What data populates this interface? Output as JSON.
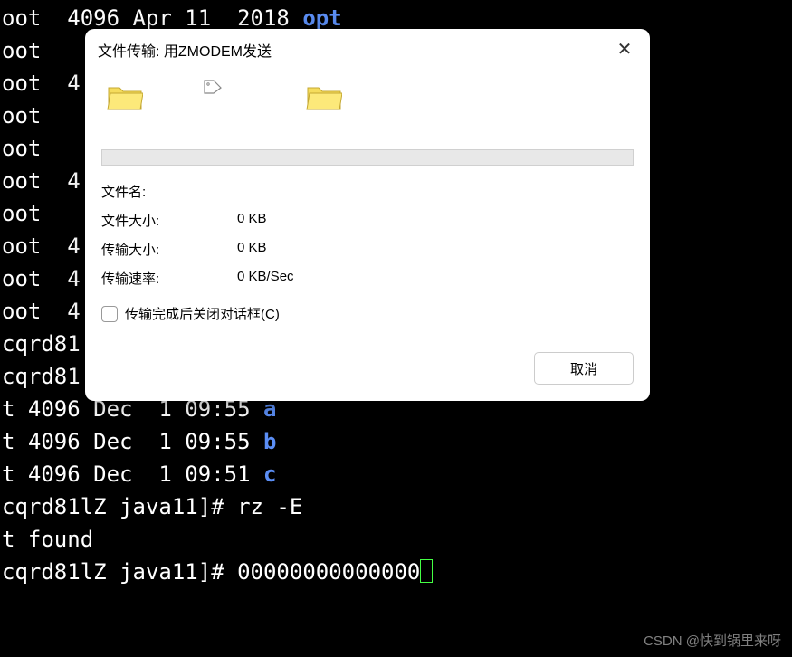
{
  "terminal": {
    "lines": [
      {
        "prefix": "oot  4096 Apr 11  2018 ",
        "suffix": "opt",
        "suffixClass": "term-blue"
      },
      {
        "prefix": "oot",
        "suffix": ""
      },
      {
        "prefix": "oot  4",
        "suffix": ""
      },
      {
        "prefix": "oot",
        "suffix": ""
      },
      {
        "prefix": "oot",
        "suffix": ""
      },
      {
        "prefix": "oot  4",
        "suffix": ""
      },
      {
        "prefix": "oot",
        "suffix": ""
      },
      {
        "prefix": "oot  4",
        "suffix": ""
      },
      {
        "prefix": "oot  4",
        "suffix": ""
      },
      {
        "prefix": "oot  4",
        "suffix": ""
      },
      {
        "prefix": "cqrd81",
        "suffix": ""
      },
      {
        "prefix": "cqrd81",
        "suffix": ""
      },
      {
        "prefix": "",
        "suffix": ""
      },
      {
        "prefix": "t 4096 Dec  1 09:55 ",
        "suffix": "a",
        "suffixClass": "term-blue"
      },
      {
        "prefix": "t 4096 Dec  1 09:55 ",
        "suffix": "b",
        "suffixClass": "term-blue"
      },
      {
        "prefix": "t 4096 Dec  1 09:51 ",
        "suffix": "c",
        "suffixClass": "term-blue"
      },
      {
        "prefix": "cqrd81lZ java11]# rz -E",
        "suffix": ""
      },
      {
        "prefix": "t found",
        "suffix": ""
      },
      {
        "prefix": "cqrd81lZ java11]# 00000000000000",
        "suffix": "",
        "hasCursor": true
      }
    ]
  },
  "dialog": {
    "title": "文件传输: 用ZMODEM发送",
    "labels": {
      "filename": "文件名:",
      "filesize": "文件大小:",
      "transfer_size": "传输大小:",
      "transfer_rate": "传输速率:"
    },
    "values": {
      "filename": "",
      "filesize": "0 KB",
      "transfer_size": "0 KB",
      "transfer_rate": "0 KB/Sec"
    },
    "checkbox_label": "传输完成后关闭对话框(C)",
    "cancel_button": "取消"
  },
  "watermark": "CSDN @快到锅里来呀"
}
